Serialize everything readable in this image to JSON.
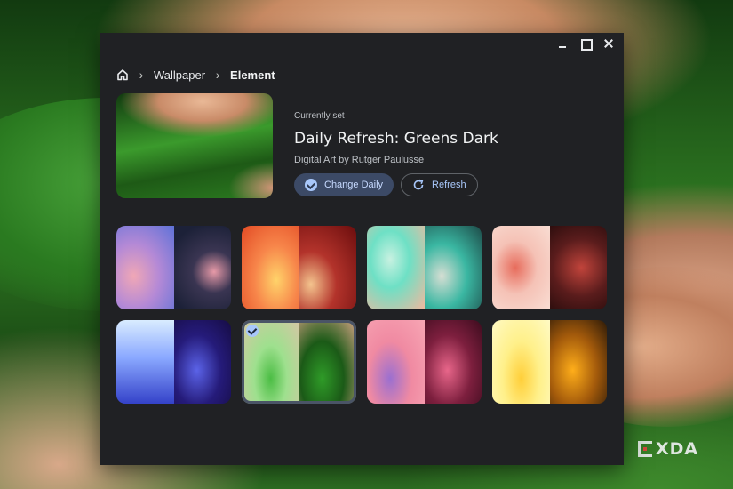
{
  "window": {
    "controls": [
      "minimize",
      "maximize",
      "close"
    ]
  },
  "breadcrumb": {
    "home_icon": "home-icon",
    "items": [
      {
        "label": "Wallpaper",
        "current": false
      },
      {
        "label": "Element",
        "current": true
      }
    ],
    "separator": "›"
  },
  "current": {
    "label": "Currently set",
    "title": "Daily Refresh: Greens Dark",
    "subtitle": "Digital Art by Rutger Paulusse",
    "change_daily_label": "Change Daily",
    "refresh_label": "Refresh"
  },
  "wallpapers": [
    {
      "name": "purple-blue-glass",
      "selected": false
    },
    {
      "name": "orange-red-shapes",
      "selected": false
    },
    {
      "name": "teal-mint-bubbles",
      "selected": false
    },
    {
      "name": "pink-red-spheres",
      "selected": false
    },
    {
      "name": "blue-indigo-waves",
      "selected": false
    },
    {
      "name": "greens",
      "selected": true
    },
    {
      "name": "pink-magenta-waves",
      "selected": false
    },
    {
      "name": "yellow-amber-waves",
      "selected": false
    }
  ],
  "watermark": "XDA",
  "colors": {
    "window_bg": "#202124",
    "accent": "#a8c7fa",
    "primary_button_bg": "#3c4a66"
  }
}
